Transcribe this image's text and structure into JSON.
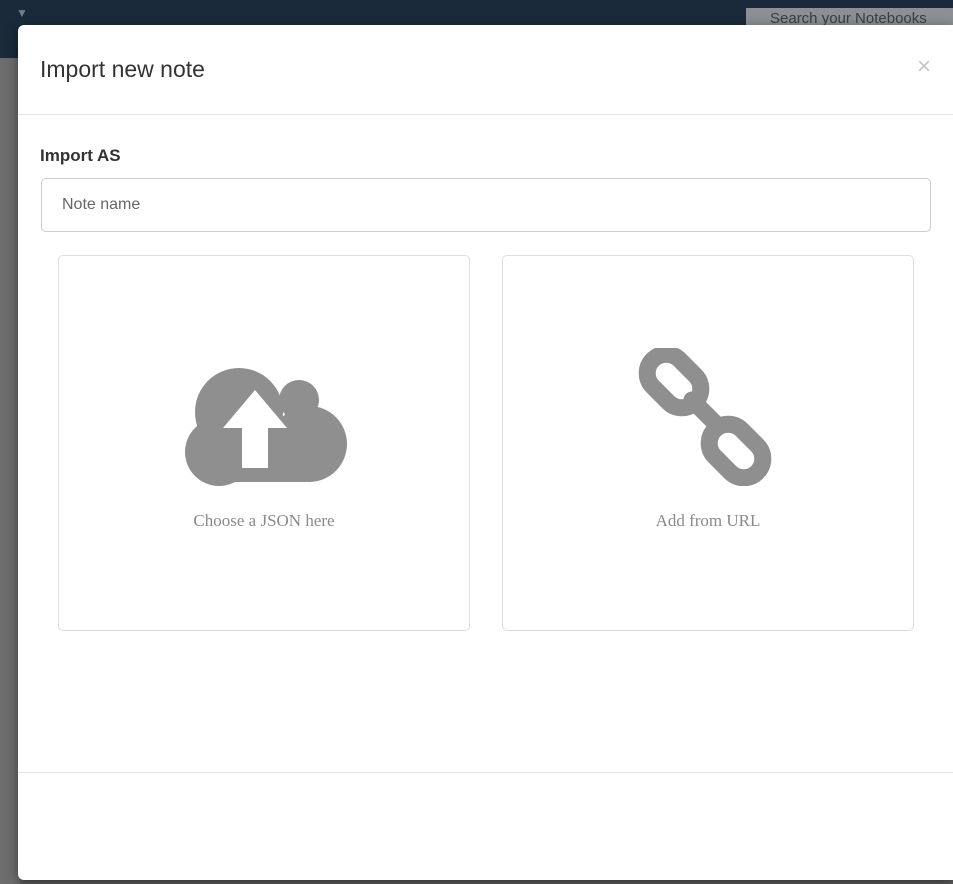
{
  "background": {
    "search_placeholder": "Search your Notebooks"
  },
  "modal": {
    "title": "Import new note",
    "close_label": "×",
    "form": {
      "label": "Import AS",
      "name_placeholder": "Note name",
      "name_value": ""
    },
    "options": [
      {
        "label": "Choose a JSON here",
        "icon": "cloud-upload-icon"
      },
      {
        "label": "Add from URL",
        "icon": "link-icon"
      }
    ]
  },
  "colors": {
    "icon_gray": "#8f8f8f",
    "label_gray": "#8a8a8a",
    "topbar": "#1b2a3a"
  }
}
